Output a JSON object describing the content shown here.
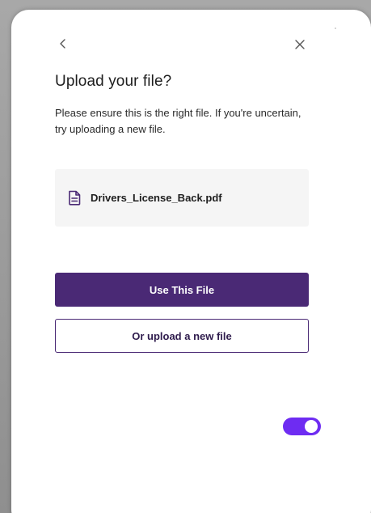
{
  "dialog": {
    "title": "Upload your file?",
    "description": "Please ensure this is the right file. If you're uncertain, try uploading a new file.",
    "file": {
      "name": "Drivers_License_Back.pdf",
      "icon": "document-icon"
    },
    "primary_button": "Use This File",
    "secondary_button": "Or upload a new file",
    "back_icon": "chevron-left-icon",
    "close_icon": "close-icon"
  },
  "toggle": {
    "state": "on",
    "color": "#6e2cf2"
  },
  "colors": {
    "primary": "#4a2975",
    "accent": "#6e2cf2",
    "card_bg": "#f5f5f5"
  }
}
